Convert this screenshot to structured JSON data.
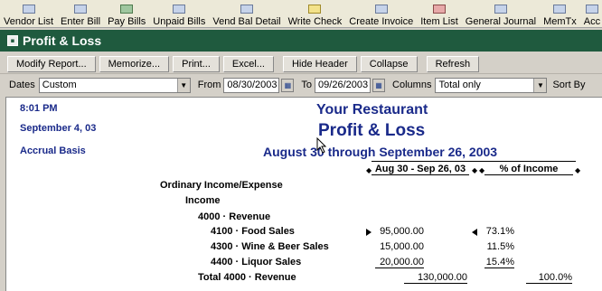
{
  "toolbar": {
    "items": [
      {
        "label": "Vendor List",
        "icon": "vendor-list-icon"
      },
      {
        "label": "Enter Bill",
        "icon": "enter-bill-icon"
      },
      {
        "label": "Pay Bills",
        "icon": "pay-bills-icon"
      },
      {
        "label": "Unpaid Bills",
        "icon": "unpaid-bills-icon"
      },
      {
        "label": "Vend Bal Detail",
        "icon": "vend-bal-detail-icon"
      },
      {
        "label": "Write Check",
        "icon": "write-check-icon"
      },
      {
        "label": "Create Invoice",
        "icon": "create-invoice-icon"
      },
      {
        "label": "Item List",
        "icon": "item-list-icon"
      },
      {
        "label": "General Journal",
        "icon": "general-journal-icon"
      },
      {
        "label": "MemTx",
        "icon": "memtx-icon"
      },
      {
        "label": "Acc",
        "icon": "acc-icon"
      }
    ]
  },
  "window": {
    "title": "Profit & Loss",
    "title_bar_color": "#1f5a3e"
  },
  "buttons": {
    "modify_report": "Modify Report...",
    "memorize": "Memorize...",
    "print": "Print...",
    "excel": "Excel...",
    "hide_header": "Hide Header",
    "collapse": "Collapse",
    "refresh": "Refresh"
  },
  "filters": {
    "dates_label": "Dates",
    "dates_value": "Custom",
    "from_label": "From",
    "from_value": "08/30/2003",
    "to_label": "To",
    "to_value": "09/26/2003",
    "columns_label": "Columns",
    "columns_value": "Total only",
    "sort_label": "Sort By"
  },
  "report": {
    "time": "8:01 PM",
    "date": "September 4, 03",
    "basis": "Accrual Basis",
    "company": "Your Restaurant",
    "title": "Profit & Loss",
    "period": "August 30 through September 26, 2003",
    "col1_header": "Aug 30 - Sep 26, 03",
    "col2_header": "% of Income",
    "rows": {
      "ordinary": "Ordinary Income/Expense",
      "income": "Income",
      "revenue": "4000 · Revenue",
      "food": {
        "label": "4100 · Food Sales",
        "amount": "95,000.00",
        "pct": "73.1%"
      },
      "wine": {
        "label": "4300 · Wine & Beer Sales",
        "amount": "15,000.00",
        "pct": "11.5%"
      },
      "liquor": {
        "label": "4400 · Liquor Sales",
        "amount": "20,000.00",
        "pct": "15.4%"
      },
      "total_revenue": {
        "label": "Total 4000 · Revenue",
        "amount": "130,000.00",
        "pct": "100.0%"
      }
    },
    "text_color": "#1a2a8a"
  }
}
